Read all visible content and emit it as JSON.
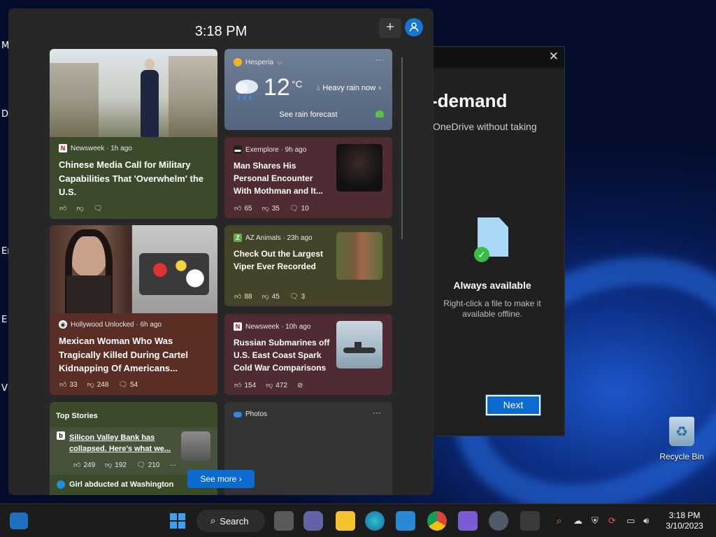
{
  "desktop": {
    "left_letters": [
      "M",
      "D",
      "Er",
      "E",
      "V"
    ],
    "recycle_bin_label": "Recycle Bin"
  },
  "onedrive": {
    "title_visible": "-demand",
    "subtitle_visible": "OneDrive without taking",
    "availability_title": "Always available",
    "availability_help": "Right-click a file to make it available offline.",
    "next_label": "Next",
    "close_icon": "close-icon"
  },
  "panel": {
    "time": "3:18 PM",
    "add_label": "+",
    "see_more_label": "See more",
    "cards": {
      "newsweek_military": {
        "source": "Newsweek · 1h ago",
        "headline": "Chinese Media Call for Military Capabilities That 'Overwhelm' the U.S."
      },
      "weather": {
        "location": "Hesperia",
        "temp": "12",
        "unit": "°C",
        "condition": "Heavy rain now",
        "forecast_link": "See rain forecast"
      },
      "mothman": {
        "source": "Exemplore · 9h ago",
        "headline": "Man Shares His Personal Encounter With Mothman and It...",
        "likes": "65",
        "dislikes": "35",
        "comments": "10"
      },
      "viper": {
        "source": "AZ Animals · 23h ago",
        "headline": "Check Out the Largest Viper Ever Recorded",
        "likes": "88",
        "dislikes": "45",
        "comments": "3"
      },
      "cartel": {
        "source": "Hollywood Unlocked · 6h ago",
        "headline": "Mexican Woman Who Was Tragically Killed During Cartel Kidnapping Of Americans...",
        "likes": "33",
        "dislikes": "248",
        "comments": "54"
      },
      "submarines": {
        "source": "Newsweek · 10h ago",
        "headline": "Russian Submarines off U.S. East Coast Spark Cold War Comparisons",
        "likes": "154",
        "dislikes": "472"
      },
      "top_stories": {
        "label": "Top Stories",
        "item1": "Silicon Valley Bank has collapsed. Here's what we...",
        "item1_likes": "249",
        "item1_dislikes": "192",
        "item1_comments": "210",
        "item2": "Girl abducted at Washington"
      },
      "photos": {
        "label": "Photos"
      }
    }
  },
  "taskbar": {
    "search_label": "Search",
    "time": "3:18 PM",
    "date": "3/10/2023"
  },
  "colors": {
    "accent": "#0b6bd0",
    "panel_bg": "#272727",
    "card_green": "#3c4a2c",
    "card_maroon": "#4e2c32",
    "card_olive": "#45432a",
    "card_brown": "#5a2e24"
  }
}
